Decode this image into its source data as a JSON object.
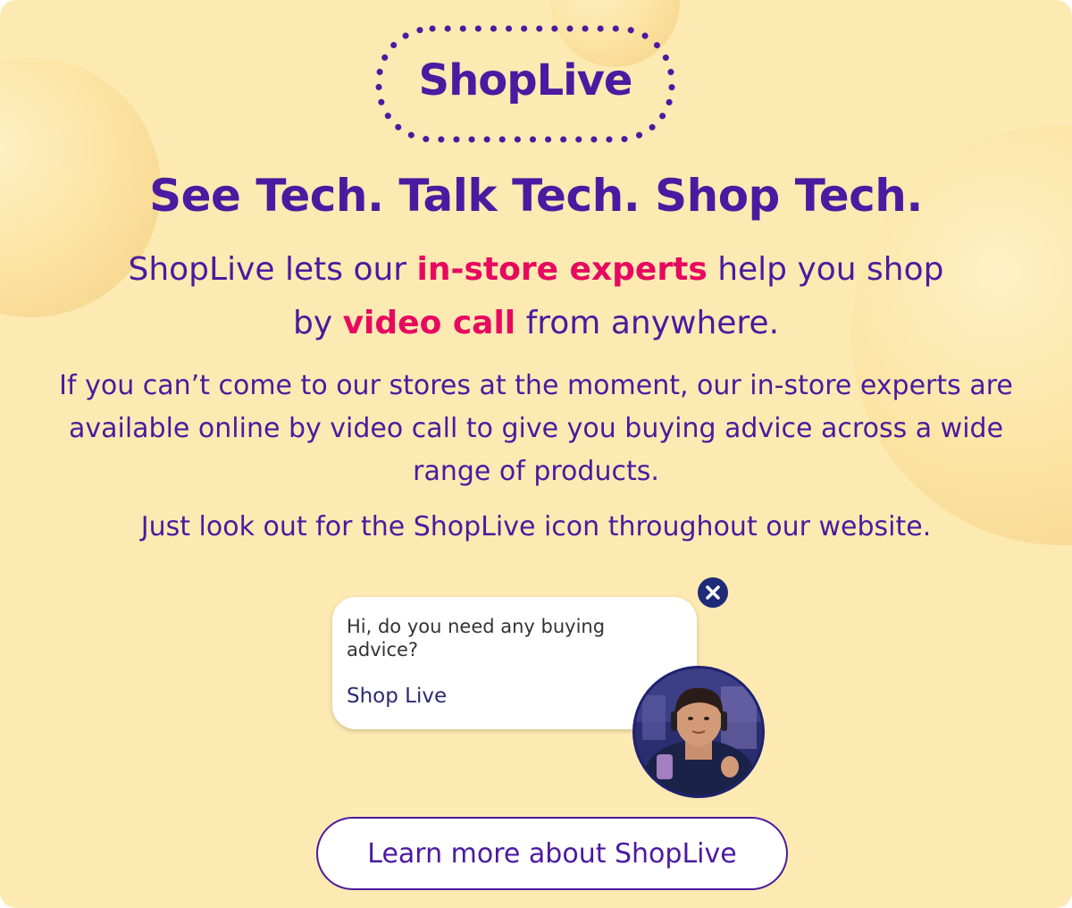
{
  "brand": {
    "logo_text": "ShopLive"
  },
  "headline": "See Tech. Talk Tech. Shop Tech.",
  "subheadline": {
    "part1": "ShopLive lets our ",
    "highlight1": "in-store experts",
    "part2": " help you shop",
    "part3": "by ",
    "highlight2": "video call",
    "part4": " from anywhere."
  },
  "body": {
    "paragraph1": "If you can’t come to our stores at the moment, our in-store experts are available online by video call to give you buying advice across a wide range of products.",
    "paragraph2": "Just look out for the ShopLive icon throughout our website."
  },
  "chat_widget": {
    "message": "Hi, do you need any buying advice?",
    "sender": "Shop Live",
    "close_icon": "close-icon",
    "avatar": "expert-avatar"
  },
  "cta": {
    "label": "Learn more about ShopLive"
  },
  "colors": {
    "background": "#fdeab2",
    "primary": "#4b1aa0",
    "accent": "#e6095f",
    "close_button": "#1f2a78"
  }
}
